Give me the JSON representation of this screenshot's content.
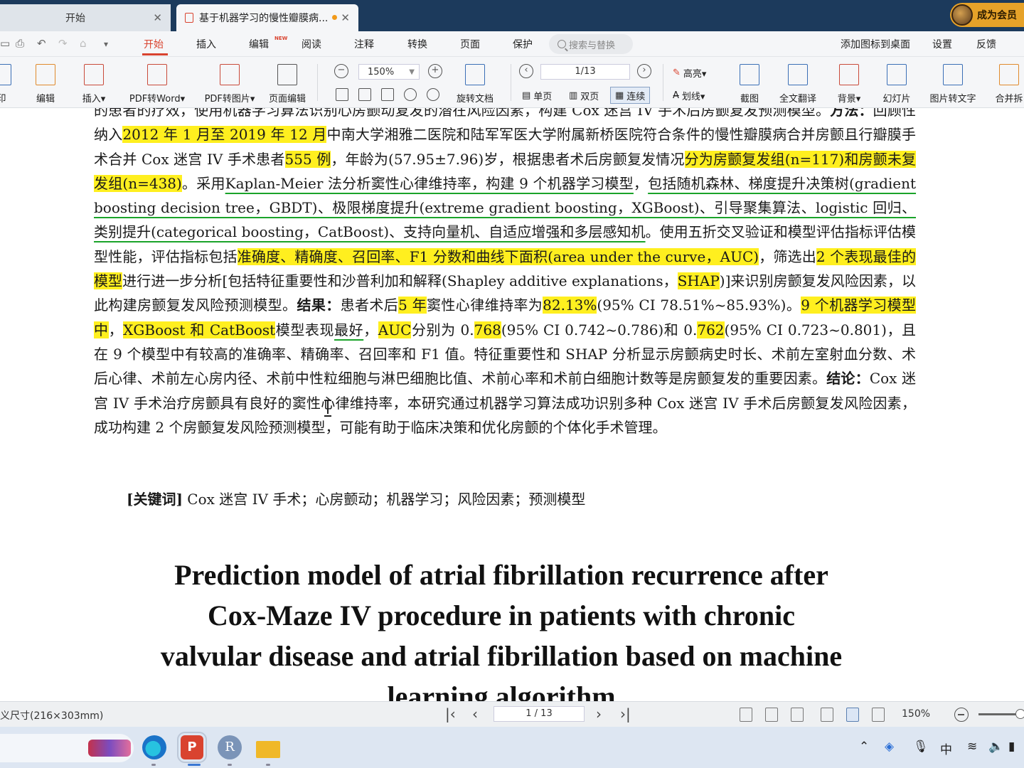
{
  "tabs": {
    "home": "开始",
    "document": "基于机器学习的慢性瓣膜病...",
    "member": "成为会员"
  },
  "menu": {
    "items": [
      "开始",
      "插入",
      "编辑",
      "阅读",
      "注释",
      "转换",
      "页面",
      "保护"
    ],
    "edit_badge": "NEW",
    "search_placeholder": "搜索与替换",
    "right": [
      "添加图标到桌面",
      "设置",
      "反馈"
    ]
  },
  "ribbon": {
    "print": "印",
    "edit": "编辑",
    "insert": "插入▾",
    "pdf_to_word": "PDF转Word▾",
    "pdf_to_image": "PDF转图片▾",
    "page_edit": "页面编辑",
    "zoom": "150%",
    "rotate_doc": "旋转文档",
    "page_indicator": "1/13",
    "single": "单页",
    "double": "双页",
    "continuous": "连续",
    "highlight": "高亮▾",
    "strikeout": "划线▾",
    "screenshot": "截图",
    "translate": "全文翻译",
    "background": "背景▾",
    "slideshow": "幻灯片",
    "img_to_text": "图片转文字",
    "merge": "合并拆"
  },
  "document": {
    "line1": "房颤复发组(n=117)和房颤未复发组(n=438)。采用",
    "partial_top": "的患者的疗效，使用机器学习算法识别心房颤动复发的潜在风险因素，构建 Cox 迷宫 IV 手术后房颤复发预测模型。",
    "p_patients": "患者的疗效，使用机器学习算法识别心房颤动复发的潜在风险因素，构建 Cox 迷宫 IV 手术后房颤复发预测模型。",
    "methods_label": "方法：",
    "m1": "回顾性纳入",
    "m_date": "2012 年 1 月至 2019 年 12 月",
    "m2": "中南大学湘雅二医院和陆军军医大学附属新桥医院符合条件的慢性瓣膜病合并房颤且行瓣膜手术合并 Cox 迷宫 IV 手术患者",
    "m_n": "555 例",
    "m3": "，年龄为(57.95±7.96)岁，根据患者术后房颤复发情况",
    "m_groups": "分为房颤复发组(n=117)和房颤未复发组(n=438)",
    "m4": "。采用",
    "m_km": "Kaplan-Meier 法分析窦性心律维持率，构建 9 个机器学习模型",
    "m5": "，",
    "m_models": "包括随机森林、梯度提升决策树(gradient boosting decision tree，GBDT)、极限梯度提升(extreme gradient boosting，XGBoost)、引导聚集算法、logistic 回归、类别提升(categorical boosting，CatBoost)、支持向量机、自适应增强和多层感知机",
    "m6": "。使用五折交叉验证和模型评估指标评估模型性能，评估指标包括",
    "m_metrics": "准确度、精确度、召回率、F1 分数和曲线下面积(area under the curve，AUC)",
    "m7": "，筛选出",
    "m_best": "2 个表现最佳的模型",
    "m8": "进行进一步分析[包括特征重要性和沙普利加和解释(Shapley additive explanations，",
    "m_shap": "SHAP",
    "m9": ")]来识别房颤复发风险因素，以此构建房颤复发风险预测模型。",
    "results_label": "结果：",
    "r1": "患者术后",
    "r_5y": "5 年",
    "r2": "窦性心律维持率为",
    "r_rate": "82.13%",
    "r3": "(95% CI 78.51%~85.93%)。",
    "r_9": "9 个机器学习模型中",
    "r4": "，",
    "r_xc": "XGBoost 和 CatBoost",
    "r5": "模型表现",
    "r_best": "最好",
    "r6": "，",
    "r_auc": "AUC",
    "r7": "分别为 0.",
    "r_768": "768",
    "r8": "(95% CI 0.742~0.786)和 0.",
    "r_762": "762",
    "r9": "(95% CI 0.723~0.801)，且在 9 个模型中有较高的准确率、精确率、召回率和 F1 值。特征重要性和 SHAP 分析显示房颤病史时长、术前左室射血分数、术后心律、术前左心房内径、术前中性粒细胞与淋巴细胞比值、术前心率和术前白细胞计数等是房颤复发的重要因素。",
    "conclusion_label": "结论：",
    "c1": "Cox 迷宫 IV 手术治疗房颤具有良好的窦性心律维持率，本研究通过机器学习算法成功识别多种 Cox 迷宫 IV 手术后房颤复发风险因素，成功构建 2 个房颤复发风险预测模型，可能有助于临床决策和优化房颤的个体化手术管理。",
    "keywords_label": "[关键词]",
    "keywords": "Cox 迷宫 IV 手术；心房颤动；机器学习；风险因素；预测模型",
    "en_title_1": "Prediction model of atrial fibrillation recurrence after",
    "en_title_2": "Cox-Maze IV procedure in patients with chronic",
    "en_title_3": "valvular disease and atrial fibrillation based on machine",
    "en_title_4": "learning algorithm"
  },
  "statusbar": {
    "page_size": "义尺寸(216×303mm)",
    "page_nav": "1 / 13",
    "zoom": "150%"
  },
  "taskbar": {
    "tray_ime": "中",
    "pdf_app": "P",
    "r_app": "R"
  },
  "colors": {
    "highlight": "#ffef1f",
    "underline": "#1aa329",
    "accent": "#d9432f",
    "titlebar": "#1c3a5c"
  }
}
